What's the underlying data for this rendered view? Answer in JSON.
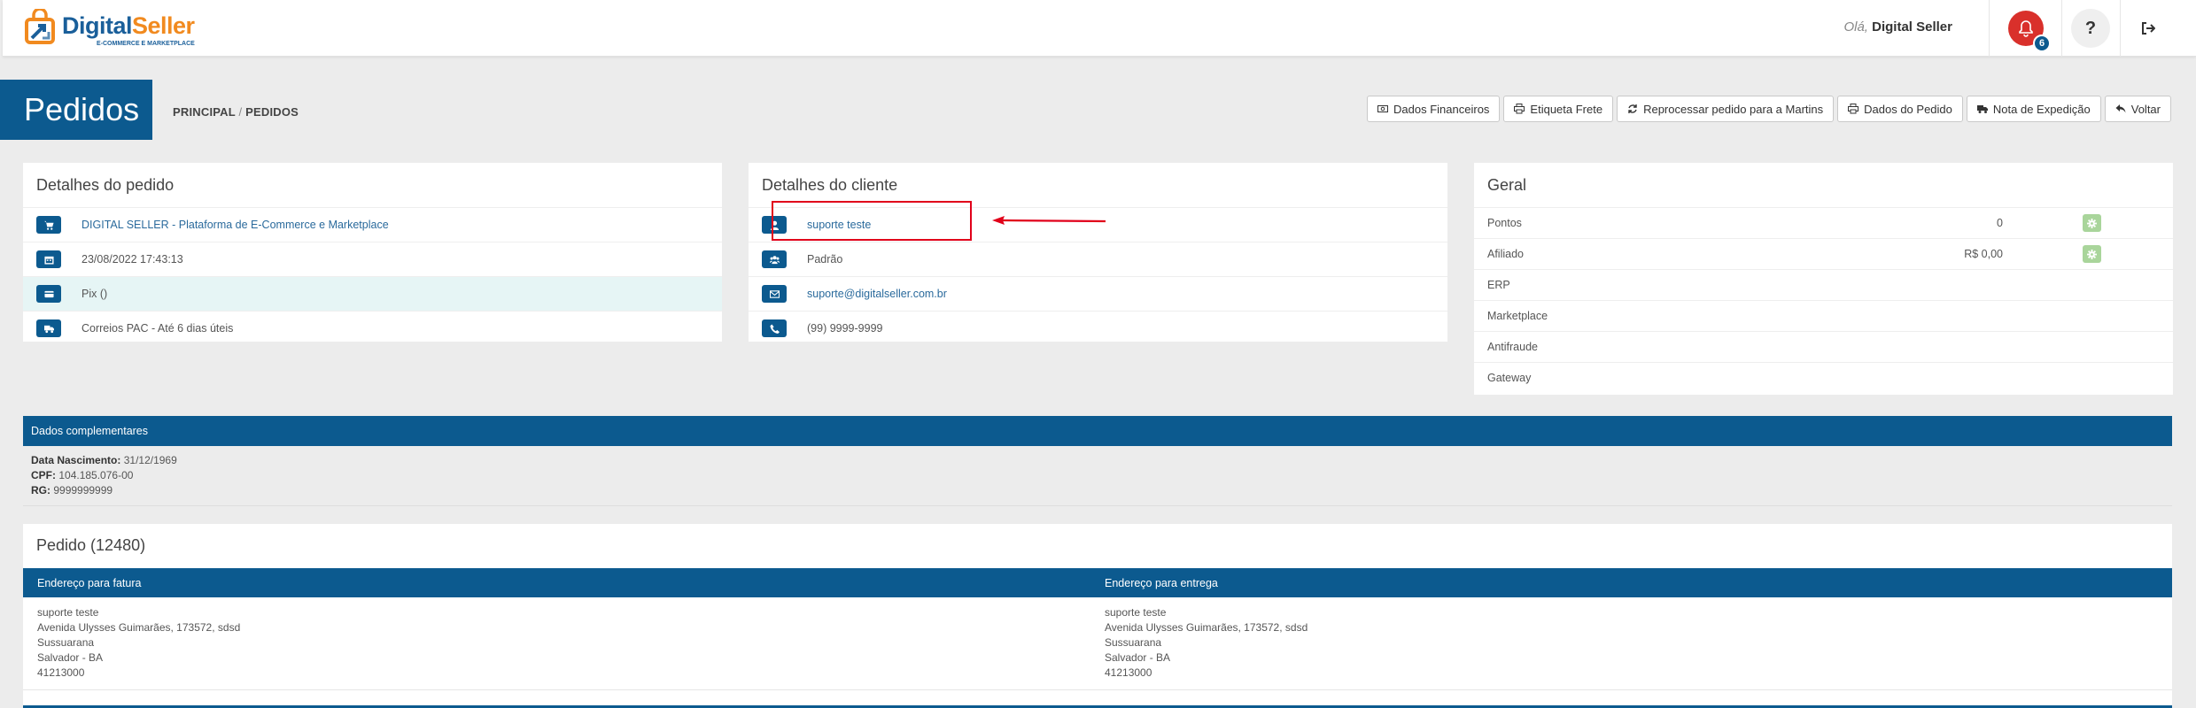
{
  "header": {
    "logo_digital": "Digital",
    "logo_seller": "Seller",
    "logo_sub": "E-COMMERCE E MARKETPLACE",
    "greeting_prefix": "Olá,",
    "user_name": "Digital Seller",
    "notification_count": "6",
    "help_label": "?"
  },
  "page": {
    "title": "Pedidos",
    "breadcrumb_root": "PRINCIPAL",
    "breadcrumb_sep": "/",
    "breadcrumb_current": "PEDIDOS"
  },
  "toolbar": {
    "dados_financeiros": "Dados Financeiros",
    "etiqueta_frete": "Etiqueta Frete",
    "reprocessar": "Reprocessar pedido para a Martins",
    "dados_pedido": "Dados do Pedido",
    "nota_expedicao": "Nota de Expedição",
    "voltar": "Voltar"
  },
  "order_details": {
    "title": "Detalhes do pedido",
    "store": "DIGITAL SELLER - Plataforma de E-Commerce e Marketplace",
    "date": "23/08/2022 17:43:13",
    "payment": "Pix ()",
    "shipping": "Correios PAC - Até 6 dias úteis"
  },
  "client_details": {
    "title": "Detalhes do cliente",
    "name": "suporte teste",
    "group": "Padrão",
    "email": "suporte@digitalseller.com.br",
    "phone": "(99) 9999-9999"
  },
  "general": {
    "title": "Geral",
    "rows": [
      {
        "label": "Pontos",
        "value": "0"
      },
      {
        "label": "Afiliado",
        "value": "R$ 0,00"
      },
      {
        "label": "ERP",
        "value": ""
      },
      {
        "label": "Marketplace",
        "value": ""
      },
      {
        "label": "Antifraude",
        "value": ""
      },
      {
        "label": "Gateway",
        "value": ""
      }
    ]
  },
  "complementary": {
    "title": "Dados complementares",
    "birth_label": "Data Nascimento:",
    "birth_value": "31/12/1969",
    "cpf_label": "CPF:",
    "cpf_value": "104.185.076-00",
    "rg_label": "RG:",
    "rg_value": "9999999999"
  },
  "order": {
    "title": "Pedido (12480)",
    "billing_title": "Endereço para fatura",
    "shipping_title": "Endereço para entrega",
    "billing": {
      "name": "suporte teste",
      "street": "Avenida Ulysses Guimarães, 173572, sdsd",
      "district": "Sussuarana",
      "city": "Salvador - BA",
      "zip": "41213000"
    },
    "shipping": {
      "name": "suporte teste",
      "street": "Avenida Ulysses Guimarães, 173572, sdsd",
      "district": "Sussuarana",
      "city": "Salvador - BA",
      "zip": "41213000"
    }
  },
  "colors": {
    "primary": "#0c5a8f",
    "alert": "#d9302b",
    "annotation": "#e1001a",
    "gear": "#a9d59b"
  }
}
